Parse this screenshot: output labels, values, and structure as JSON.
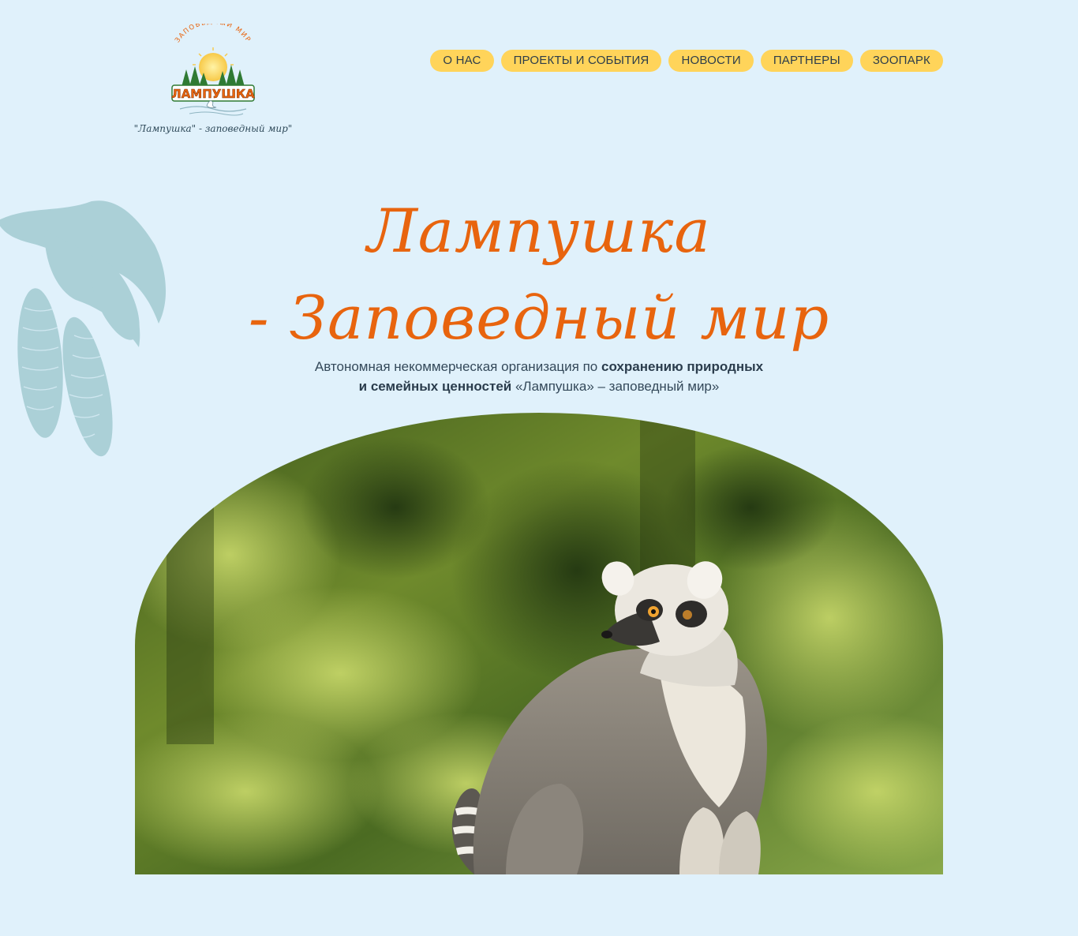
{
  "header": {
    "logo": {
      "arc_text": "ЗАПОВЕДНЫЙ МИР",
      "word": "ЛАМПУШКА",
      "tagline": "\"Лампушка\" - заповедный мир\""
    },
    "nav": [
      {
        "label": "О НАС"
      },
      {
        "label": "ПРОЕКТЫ И СОБЫТИЯ"
      },
      {
        "label": "НОВОСТИ"
      },
      {
        "label": "ПАРТНЕРЫ"
      },
      {
        "label": "ЗООПАРК"
      }
    ]
  },
  "hero": {
    "title_line1": "Лампушка",
    "title_line2": "- Заповедный мир",
    "subtitle": {
      "part1": "Автономная некоммерческая организация по ",
      "bold1": "сохранению природных",
      "bold2": "и семейных ценностей",
      "part2": " «Лампушка» – заповедный мир»"
    }
  },
  "colors": {
    "background": "#e0f1fb",
    "accent_orange": "#e8640e",
    "nav_pill": "#ffd45a",
    "text_dark": "#34495a",
    "branch": "#a9cfd6"
  },
  "icons": {
    "logo": "lampushka-logo",
    "branch": "spruce-branch-decoration",
    "photo": "lemur-photo"
  }
}
